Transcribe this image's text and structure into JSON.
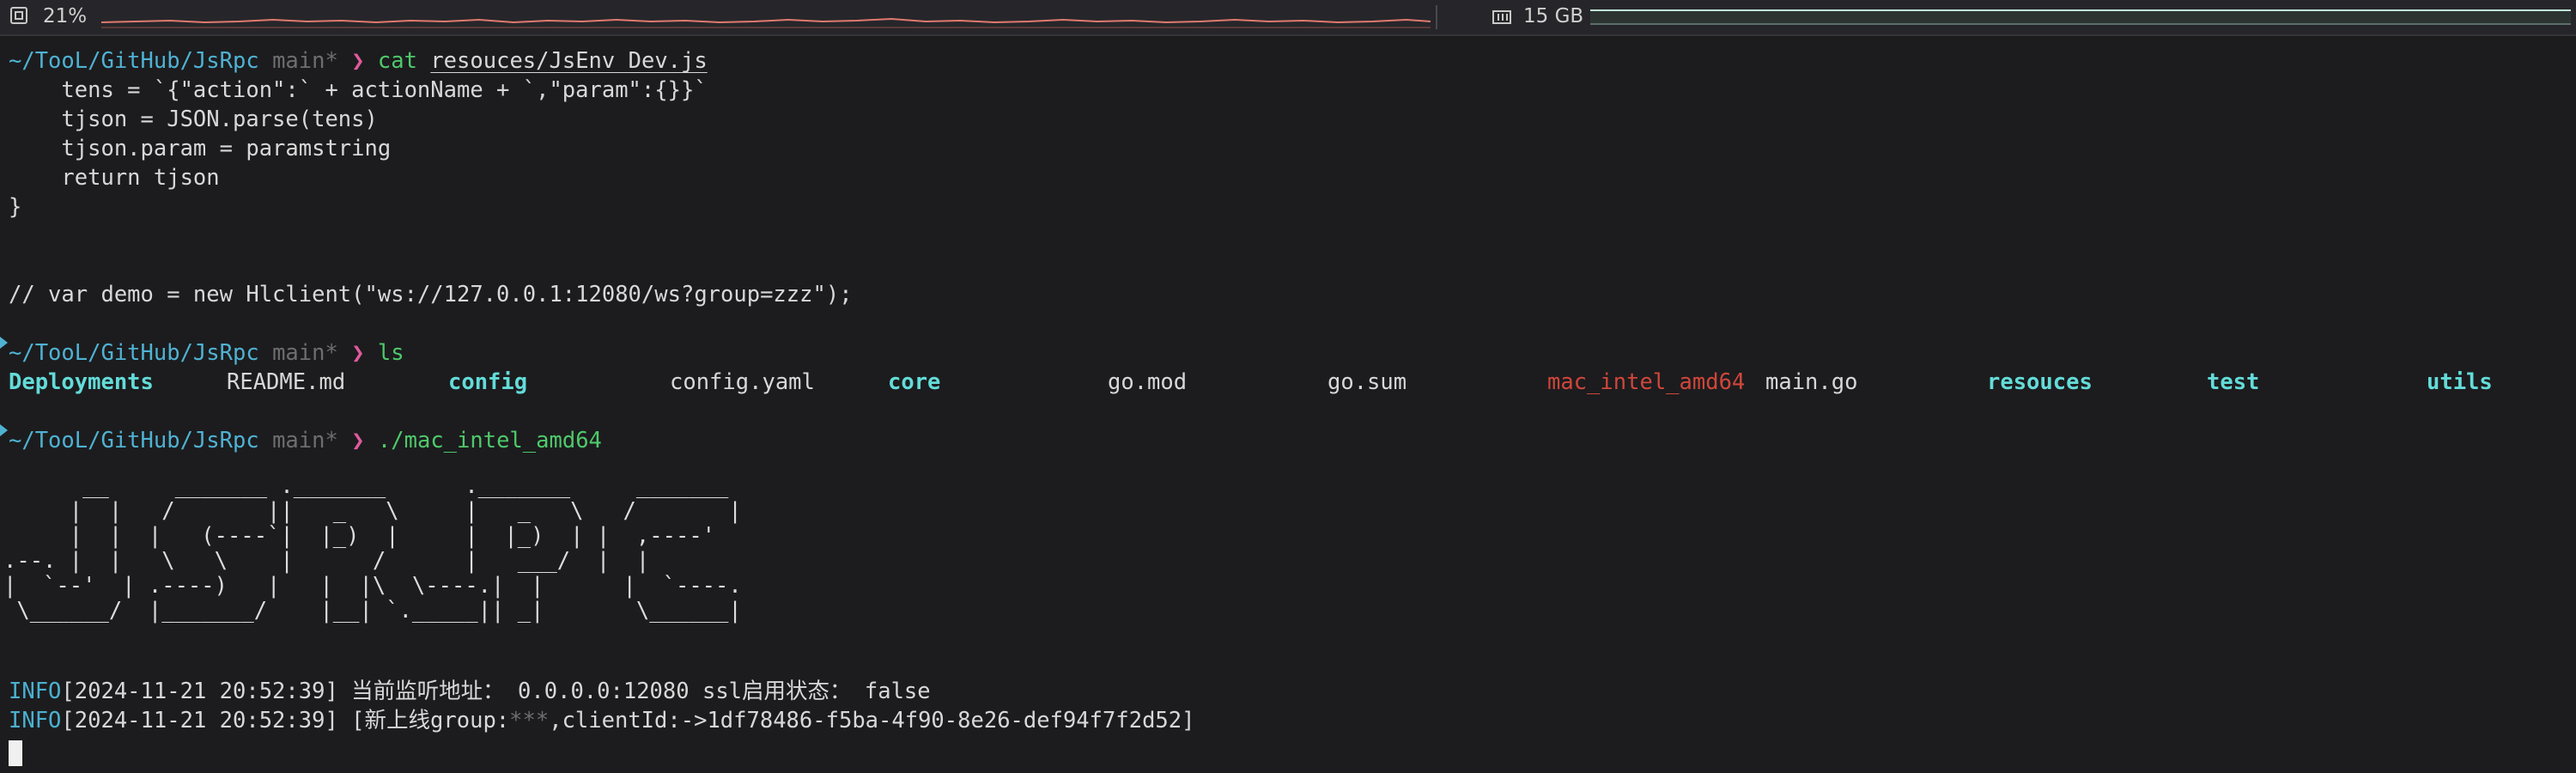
{
  "statusbar": {
    "cpu_label": "21%",
    "mem_label": "15 GB",
    "accent_cpu": "#e07a6e",
    "accent_mem": "#bfe6d7"
  },
  "terminal": {
    "prompt1": {
      "path": "~/TooL/GitHub/JsRpc",
      "branch": "main*",
      "arrow": "❯",
      "command": "cat",
      "arg": "resouces/JsEnv_Dev.js"
    },
    "code_lines": [
      "    tens = `{\"action\":` + actionName + `,\"param\":{}}`",
      "    tjson = JSON.parse(tens)",
      "    tjson.param = paramstring",
      "    return tjson",
      "}",
      "// var demo = new Hlclient(\"ws://127.0.0.1:12080/ws?group=zzz\");"
    ],
    "prompt2": {
      "path": "~/TooL/GitHub/JsRpc",
      "branch": "main*",
      "arrow": "❯",
      "command": "ls"
    },
    "ls_entries": [
      {
        "name": "Deployments",
        "kind": "dir"
      },
      {
        "name": "README.md",
        "kind": "file"
      },
      {
        "name": "config",
        "kind": "dir"
      },
      {
        "name": "config.yaml",
        "kind": "file"
      },
      {
        "name": "core",
        "kind": "dir"
      },
      {
        "name": "go.mod",
        "kind": "file"
      },
      {
        "name": "go.sum",
        "kind": "file"
      },
      {
        "name": "mac_intel_amd64",
        "kind": "exec"
      },
      {
        "name": "main.go",
        "kind": "file"
      },
      {
        "name": "resouces",
        "kind": "dir"
      },
      {
        "name": "test",
        "kind": "dir"
      },
      {
        "name": "utils",
        "kind": "dir"
      }
    ],
    "prompt3": {
      "path": "~/TooL/GitHub/JsRpc",
      "branch": "main*",
      "arrow": "❯",
      "command": "./mac_intel_amd64"
    },
    "banner": "      __     _______ ._______      ._______     _______\n     |  |   /       ||   _   \\     |   _   \\   /       |\n     |  |  |   (----`|  |_)  |     |  |_)  | |  ,----'\n.--. |  |   \\   \\    |      /      |   ___/  |  |\n|  `--'  | .----)   |   |  |\\  \\----.|  |      |  `----.\n \\______/  |_______/    |__| `._____|| _|       \\______|",
    "log1": {
      "level": "INFO",
      "time": "[2024-11-21 20:52:39]",
      "message": " 当前监听地址： 0.0.0.0:12080 ssl启用状态： false"
    },
    "log2": {
      "level": "INFO",
      "time": "[2024-11-21 20:52:39]",
      "prefix": " [新上线group:",
      "masked": "***",
      "suffix": ",clientId:->1df78486-f5ba-4f90-8e26-def94f7f2d52]"
    }
  }
}
